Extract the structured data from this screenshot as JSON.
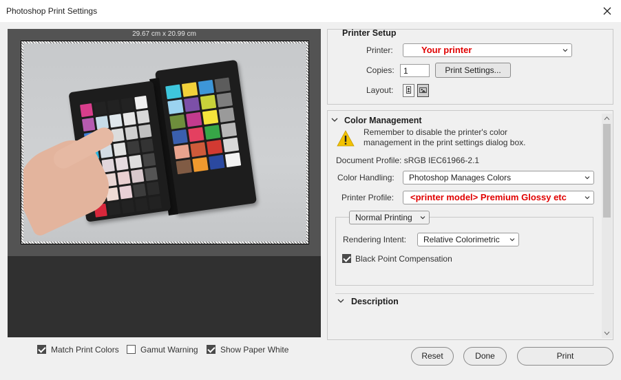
{
  "window": {
    "title": "Photoshop Print Settings"
  },
  "preview": {
    "dimensions": "29.67 cm x 20.99 cm",
    "checkboxes": [
      {
        "label": "Match Print Colors",
        "checked": true
      },
      {
        "label": "Gamut Warning",
        "checked": false
      },
      {
        "label": "Show Paper White",
        "checked": true
      }
    ]
  },
  "printer_setup": {
    "heading": "Printer Setup",
    "printer_label": "Printer:",
    "printer_value": "Your printer",
    "copies_label": "Copies:",
    "copies_value": "1",
    "print_settings_button": "Print Settings...",
    "layout_label": "Layout:",
    "layout_icons": [
      "portrait-layout-icon",
      "landscape-layout-icon"
    ],
    "layout_selected": "landscape"
  },
  "color_management": {
    "heading": "Color Management",
    "warning_text": "Remember to disable the printer's color management in the print settings dialog box.",
    "warning_line1": "Remember to disable the printer's color",
    "warning_line2": "management in the print settings dialog box.",
    "document_profile": "Document Profile: sRGB IEC61966-2.1",
    "color_handling_label": "Color Handling:",
    "color_handling_value": "Photoshop Manages Colors",
    "printer_profile_label": "Printer Profile:",
    "printer_profile_value": "<printer model> Premium Glossy etc",
    "print_mode": "Normal Printing",
    "rendering_intent_label": "Rendering Intent:",
    "rendering_intent_value": "Relative Colorimetric",
    "black_point_label": "Black Point Compensation",
    "black_point_checked": true
  },
  "description": {
    "heading": "Description"
  },
  "buttons": {
    "reset": "Reset",
    "done": "Done",
    "print": "Print"
  },
  "colors": {
    "accent_red": "#e00000",
    "preview_bg": "#535353",
    "dialog_bg": "#f0f0f0"
  }
}
